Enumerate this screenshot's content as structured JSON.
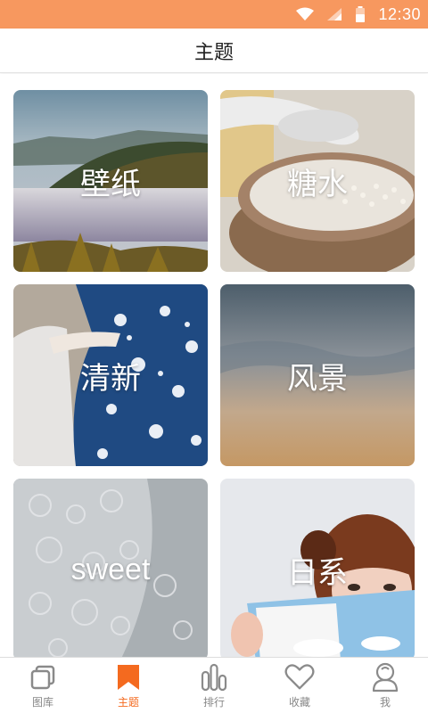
{
  "status_bar": {
    "time": "12:30",
    "icons": [
      "wifi-icon",
      "cell-signal-icon",
      "battery-icon"
    ]
  },
  "header": {
    "title": "主题"
  },
  "themes": [
    {
      "label": "壁纸",
      "image": "misty-mountain-forest"
    },
    {
      "label": "糖水",
      "image": "bowl-of-sweet-soup-with-spoon"
    },
    {
      "label": "清新",
      "image": "blue-floral-dress"
    },
    {
      "label": "风景",
      "image": "blurred-sea-and-sky"
    },
    {
      "label": "sweet",
      "image": "white-lace-fabric"
    },
    {
      "label": "日系",
      "image": "girl-reading-book"
    }
  ],
  "tab_bar": {
    "tabs": [
      {
        "label": "图库",
        "icon": "gallery-icon",
        "active": false
      },
      {
        "label": "主题",
        "icon": "bookmark-icon",
        "active": true
      },
      {
        "label": "排行",
        "icon": "ranking-bars-icon",
        "active": false
      },
      {
        "label": "收藏",
        "icon": "heart-icon",
        "active": false
      },
      {
        "label": "我",
        "icon": "profile-icon",
        "active": false
      }
    ]
  },
  "colors": {
    "status_bar": "#f7985f",
    "accent": "#f46a1f",
    "inactive": "#888888"
  }
}
